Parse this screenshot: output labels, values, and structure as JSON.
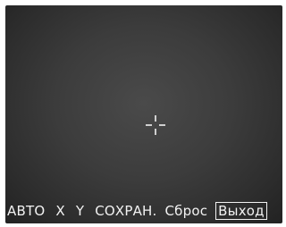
{
  "menu": {
    "auto_label": "АВТО",
    "x_label": "X",
    "y_label": "Y",
    "save_label": "СОХРАН.",
    "reset_label": "Сброс",
    "exit_label": "Выход"
  },
  "icons": {
    "crosshair": "crosshair-icon"
  },
  "colors": {
    "screen_background": "#3c3c3c",
    "menu_text": "#f2f2f2"
  }
}
